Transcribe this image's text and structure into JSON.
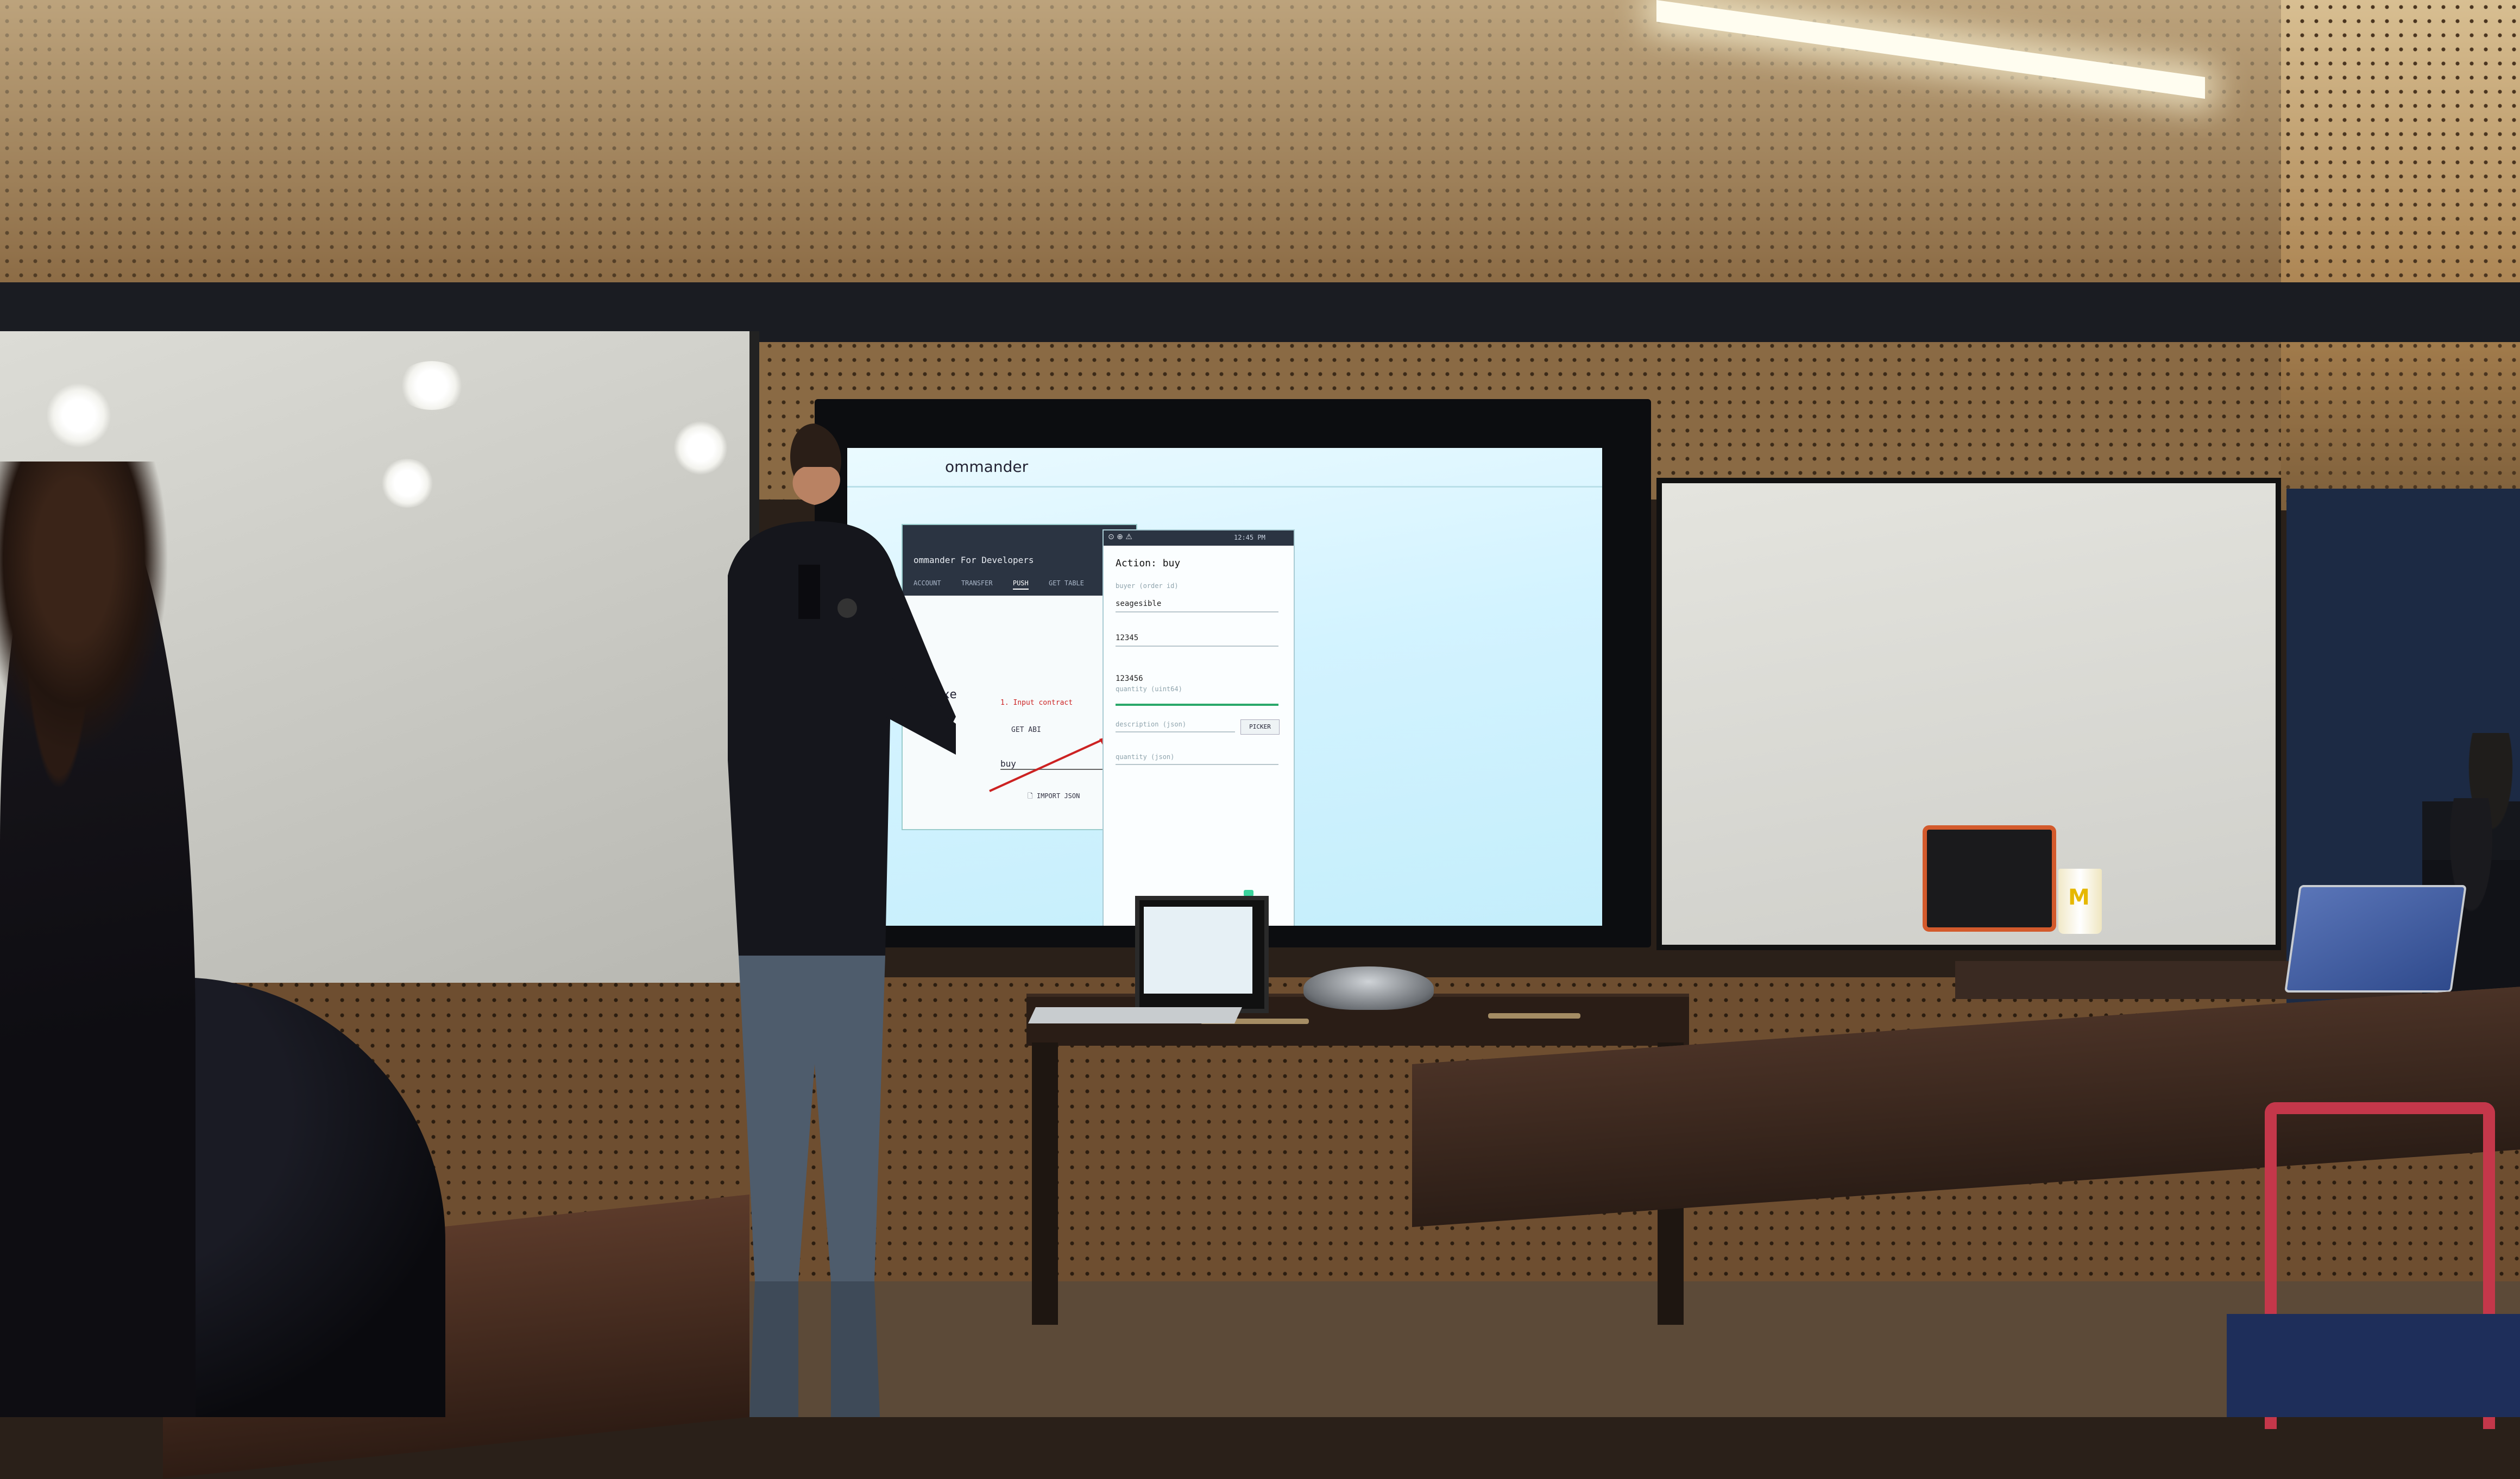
{
  "scene": {
    "description_free": true
  },
  "screen_app": {
    "app_title": "ommander"
  },
  "phone_left": {
    "title": "ommander For Developers",
    "menu_icon": "kebab-menu-icon",
    "tabs": [
      "ACCOUNT",
      "TRANSFER",
      "PUSH",
      "GET TABLE"
    ],
    "active_tab_index": 2,
    "section": "exe",
    "step": "1. Input contract",
    "get_abi": "GET ABI",
    "action_select": "buy",
    "import_json": "IMPORT JSON"
  },
  "phone_right": {
    "status_time": "12:45 PM",
    "action_header": "Action: buy",
    "fields": [
      {
        "label": "buyer (order id)",
        "value": "seagesible"
      },
      {
        "label": "",
        "value": "12345"
      },
      {
        "label": "",
        "value": "123456"
      },
      {
        "label": "quantity (uint64)",
        "value": ""
      },
      {
        "label": "description (json)",
        "value": ""
      },
      {
        "label": "quantity (json)",
        "value": ""
      }
    ],
    "picker_label": "PICKER"
  },
  "colors": {
    "screen_bg": "#d3f3ff",
    "active_line": "#2aa86a",
    "error_red": "#cc2222",
    "chair_red": "#c4374a"
  }
}
